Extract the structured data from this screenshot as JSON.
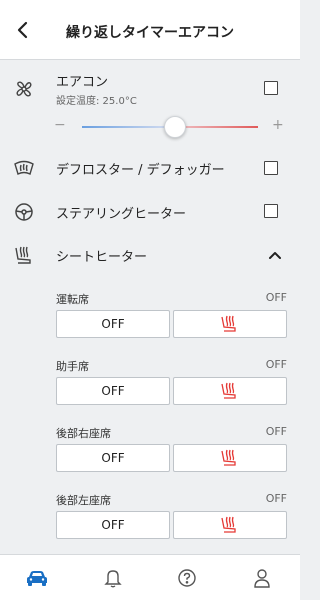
{
  "header": {
    "title": "繰り返しタイマーエアコン"
  },
  "aircon": {
    "label": "エアコン",
    "setting": "設定温度: 25.0°C",
    "slider_minus": "−",
    "slider_plus": "+"
  },
  "defroster": {
    "label": "デフロスター / デフォッガー"
  },
  "steering": {
    "label": "ステアリングヒーター"
  },
  "seat_heater": {
    "label": "シートヒーター",
    "seats": [
      {
        "name": "運転席",
        "status": "OFF",
        "off_label": "OFF"
      },
      {
        "name": "助手席",
        "status": "OFF",
        "off_label": "OFF"
      },
      {
        "name": "後部右座席",
        "status": "OFF",
        "off_label": "OFF"
      },
      {
        "name": "後部左座席",
        "status": "OFF",
        "off_label": "OFF"
      }
    ]
  },
  "tabs": [
    {
      "icon": "car-icon",
      "active": true
    },
    {
      "icon": "bell-icon",
      "active": false
    },
    {
      "icon": "help-icon",
      "active": false
    },
    {
      "icon": "person-icon",
      "active": false
    }
  ],
  "colors": {
    "accent": "#1a6fc4",
    "heat": "#e53935",
    "slider_cool": "#6a9fe0",
    "slider_warm": "#e05a5a"
  }
}
